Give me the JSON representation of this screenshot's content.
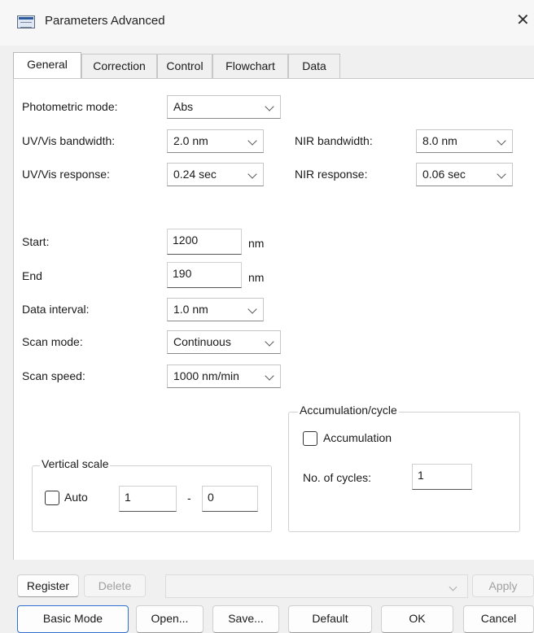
{
  "window": {
    "title": "Parameters  Advanced",
    "close_glyph": "✕",
    "app_icon": "window-app-icon"
  },
  "tabs": [
    {
      "label": "General",
      "active": true
    },
    {
      "label": "Correction",
      "active": false
    },
    {
      "label": "Control",
      "active": false
    },
    {
      "label": "Flowchart",
      "active": false
    },
    {
      "label": "Data",
      "active": false
    }
  ],
  "general": {
    "photometric_mode": {
      "label": "Photometric mode:",
      "value": "Abs"
    },
    "uvvis_bandwidth": {
      "label": "UV/Vis bandwidth:",
      "value": "2.0 nm"
    },
    "nir_bandwidth": {
      "label": "NIR bandwidth:",
      "value": "8.0 nm"
    },
    "uvvis_response": {
      "label": "UV/Vis response:",
      "value": "0.24 sec"
    },
    "nir_response": {
      "label": "NIR response:",
      "value": "0.06 sec"
    },
    "start": {
      "label": "Start:",
      "value": "1200",
      "unit": "nm"
    },
    "end": {
      "label": "End",
      "value": "190",
      "unit": "nm"
    },
    "data_interval": {
      "label": "Data interval:",
      "value": "1.0 nm"
    },
    "scan_mode": {
      "label": "Scan mode:",
      "value": "Continuous"
    },
    "scan_speed": {
      "label": "Scan speed:",
      "value": "1000 nm/min"
    }
  },
  "accumulation": {
    "title": "Accumulation/cycle",
    "checkbox_label": "Accumulation",
    "checked": false,
    "cycles_label": "No. of cycles:",
    "cycles_value": "1"
  },
  "vertical_scale": {
    "title": "Vertical scale",
    "auto_label": "Auto",
    "auto_checked": false,
    "min_value": "1",
    "separator": "-",
    "max_value": "0"
  },
  "register_bar": {
    "register_label": "Register",
    "delete_label": "Delete",
    "combo_value": "",
    "apply_label": "Apply"
  },
  "footer": {
    "basic_mode_label": "Basic Mode",
    "open_label": "Open...",
    "save_label": "Save...",
    "default_label": "Default",
    "ok_label": "OK",
    "cancel_label": "Cancel"
  }
}
